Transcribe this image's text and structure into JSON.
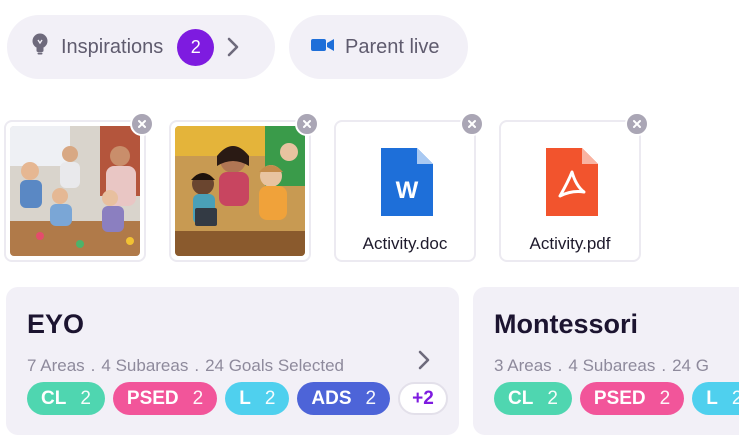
{
  "toolbar": {
    "inspirations": {
      "label": "Inspirations",
      "count": "2",
      "icon": "lightbulb-icon"
    },
    "parent_live": {
      "label": "Parent live",
      "icon": "video-camera-icon",
      "icon_color": "#1e6fd9"
    },
    "accent_color": "#7e1be0"
  },
  "attachments": [
    {
      "type": "image",
      "icon": "photo-thumbnail"
    },
    {
      "type": "image",
      "icon": "photo-thumbnail"
    },
    {
      "type": "file",
      "name": "Activity.doc",
      "icon": "word-doc-icon",
      "color": "#1e6fd9"
    },
    {
      "type": "file",
      "name": "Activity.pdf",
      "icon": "pdf-icon",
      "color": "#f2542d"
    }
  ],
  "frameworks": [
    {
      "title": "EYO",
      "meta": [
        "7 Areas",
        ".",
        "4 Subareas",
        ".",
        "24 Goals Selected"
      ],
      "chips": [
        {
          "name": "CL",
          "count": "2",
          "color": "#4fd6b0"
        },
        {
          "name": "PSED",
          "count": "2",
          "color": "#f2559a"
        },
        {
          "name": "L",
          "count": "2",
          "color": "#4fd0ee"
        },
        {
          "name": "ADS",
          "count": "2",
          "color": "#4d64d8"
        }
      ],
      "more": "+2"
    },
    {
      "title": "Montessori",
      "meta": [
        "3 Areas",
        ".",
        "4 Subareas",
        ".",
        "24 G"
      ],
      "chips": [
        {
          "name": "CL",
          "count": "2",
          "color": "#4fd6b0"
        },
        {
          "name": "PSED",
          "count": "2",
          "color": "#f2559a"
        },
        {
          "name": "L",
          "count": "2",
          "color": "#4fd0ee"
        }
      ]
    }
  ]
}
